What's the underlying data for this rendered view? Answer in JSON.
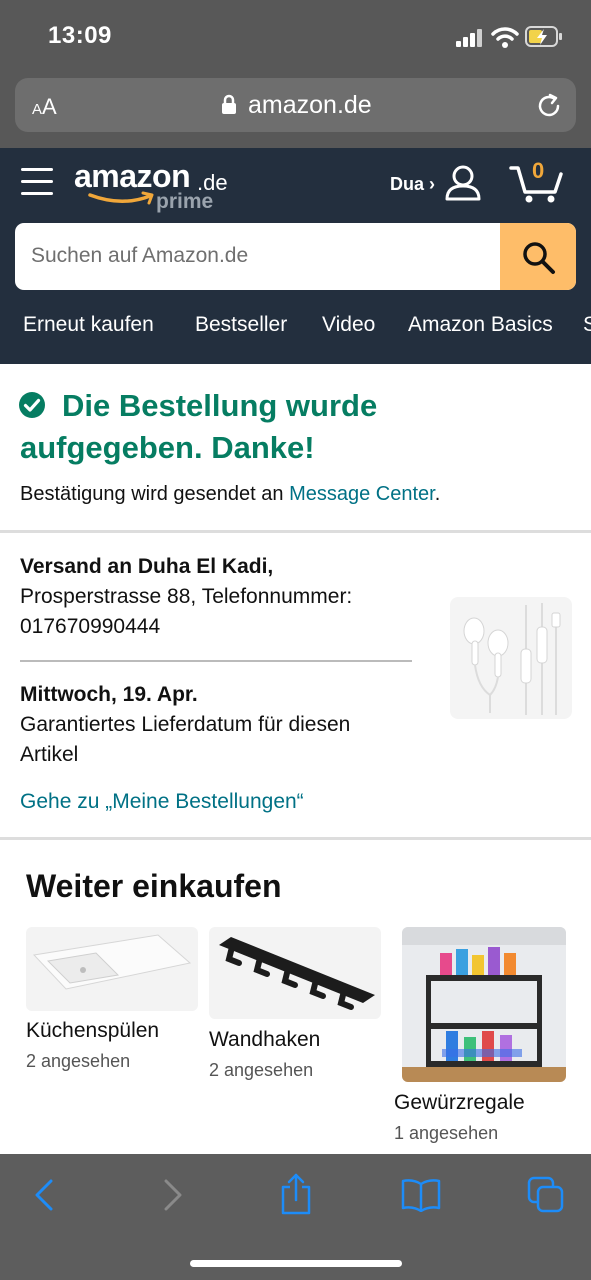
{
  "status": {
    "time": "13:09"
  },
  "browser": {
    "text_size_large": "A",
    "text_size_small": "A",
    "url": "amazon.de"
  },
  "header": {
    "logo_main": "amazon",
    "logo_tld": ".de",
    "logo_sub": "prime",
    "account_label": "Dua ›",
    "cart_count": "0",
    "search_placeholder": "Suchen auf Amazon.de",
    "nav": [
      "Erneut kaufen",
      "Bestseller",
      "Video",
      "Amazon Basics",
      "S"
    ]
  },
  "confirmation": {
    "title": "Die Bestellung wurde aufgegeben. Danke!",
    "subtitle_prefix": "Bestätigung wird gesendet an ",
    "subtitle_link": "Message Center",
    "subtitle_suffix": "."
  },
  "shipping": {
    "name": "Versand an Duha El Kadi,",
    "address": "Prosperstrasse 88, Telefonnummer: 017670990444",
    "date": "Mittwoch, 19. Apr.",
    "date_note": "Garantiertes Lieferdatum für diesen Artikel",
    "orders_link": "Gehe zu „Meine Bestellungen“"
  },
  "continue_shopping": {
    "title": "Weiter einkaufen",
    "items": [
      {
        "name": "Küchenspülen",
        "viewed": "2 angesehen"
      },
      {
        "name": "Wandhaken",
        "viewed": "2 angesehen"
      },
      {
        "name": "Gewürzregale",
        "viewed": "1 angesehen"
      }
    ]
  },
  "colors": {
    "header_bg": "#232f3e",
    "success_green": "#067d62",
    "link_teal": "#007185",
    "search_button": "#febd69",
    "cart_count": "#f0a73a",
    "toolbar_icons": "#1d8cf8"
  },
  "icons": {
    "status": [
      "signal-icon",
      "wifi-icon",
      "battery-charging-icon"
    ],
    "browser": [
      "lock-icon",
      "reload-icon"
    ],
    "header": [
      "hamburger-menu-icon",
      "account-icon",
      "cart-icon",
      "search-icon"
    ],
    "confirmation": "check-circle-icon",
    "toolbar": [
      "back-icon",
      "forward-icon",
      "share-icon",
      "bookmarks-icon",
      "tabs-icon"
    ]
  }
}
